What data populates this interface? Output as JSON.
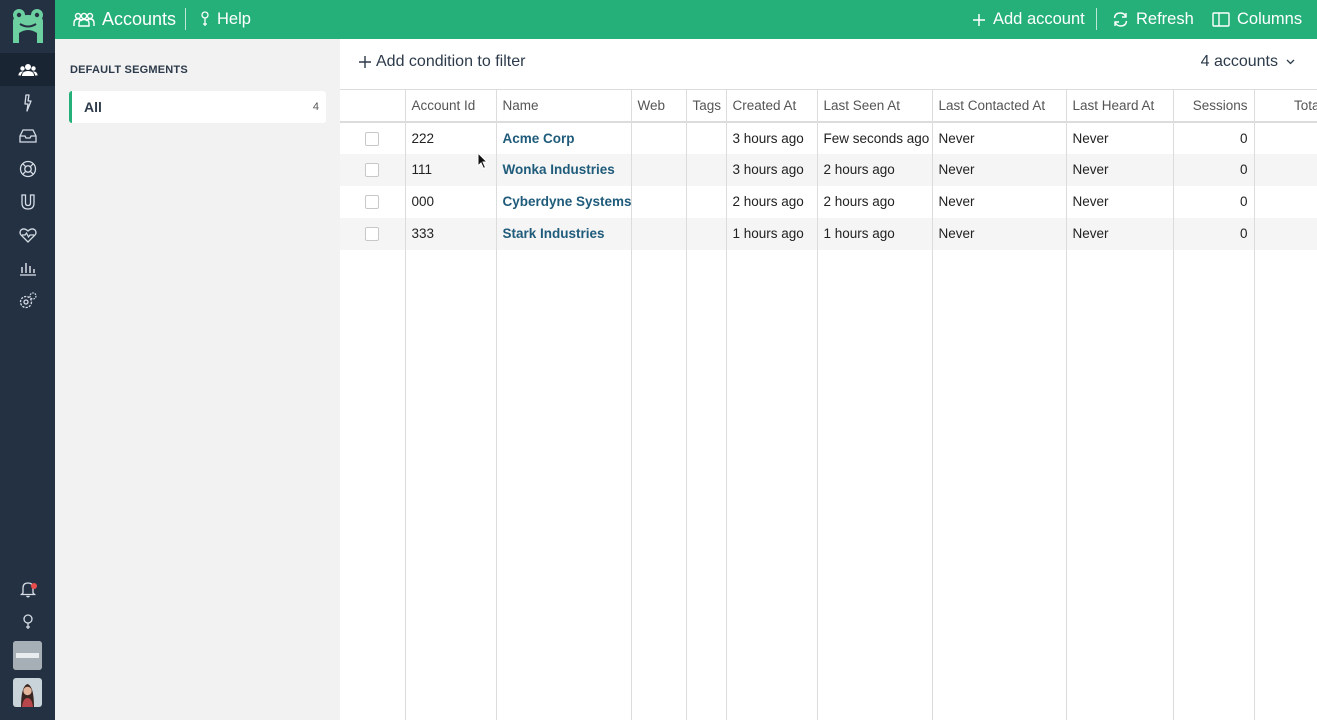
{
  "topbar": {
    "title": "Accounts",
    "help_label": "Help",
    "add_account_label": "Add account",
    "refresh_label": "Refresh",
    "columns_label": "Columns",
    "color": "#25b07a"
  },
  "leftnav": {
    "icons": [
      "users-icon",
      "lightning-icon",
      "inbox-icon",
      "lifebuoy-icon",
      "magnet-icon",
      "heart-pulse-icon",
      "bar-chart-icon",
      "settings-icon"
    ],
    "bottom_icons": [
      "bell-icon",
      "help-icon"
    ],
    "active": "users-icon",
    "color": "#233142"
  },
  "segments": {
    "heading": "DEFAULT SEGMENTS",
    "items": [
      {
        "label": "All",
        "count": "4"
      }
    ]
  },
  "main": {
    "filter_label": "Add condition to filter",
    "count_label": "4 accounts"
  },
  "table": {
    "columns": [
      "",
      "Account Id",
      "Name",
      "Web",
      "Tags",
      "Created At",
      "Last Seen At",
      "Last Contacted At",
      "Last Heard At",
      "Sessions",
      "Total Co"
    ],
    "rows": [
      {
        "id": "222",
        "name": "Acme Corp",
        "web": "",
        "tags": "",
        "created": "3 hours ago",
        "seen": "Few seconds ago",
        "contacted": "Never",
        "heard": "Never",
        "sessions": "0"
      },
      {
        "id": "111",
        "name": "Wonka Industries",
        "web": "",
        "tags": "",
        "created": "3 hours ago",
        "seen": "2 hours ago",
        "contacted": "Never",
        "heard": "Never",
        "sessions": "0"
      },
      {
        "id": "000",
        "name": "Cyberdyne Systems",
        "web": "",
        "tags": "",
        "created": "2 hours ago",
        "seen": "2 hours ago",
        "contacted": "Never",
        "heard": "Never",
        "sessions": "0"
      },
      {
        "id": "333",
        "name": "Stark Industries",
        "web": "",
        "tags": "",
        "created": "1 hours ago",
        "seen": "1 hours ago",
        "contacted": "Never",
        "heard": "Never",
        "sessions": "0"
      }
    ]
  }
}
